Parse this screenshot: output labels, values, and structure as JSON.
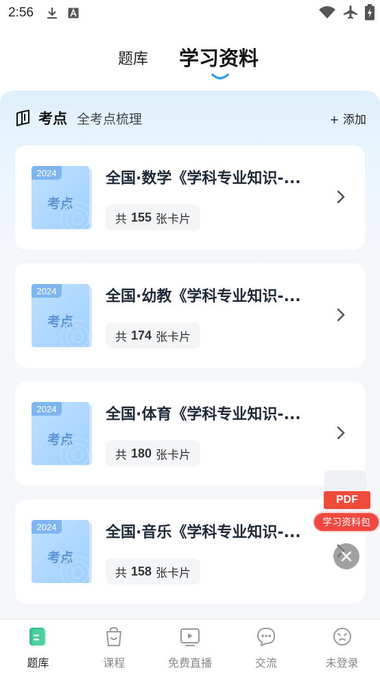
{
  "status_bar": {
    "time": "2:56"
  },
  "top_tabs": {
    "tab1": "题库",
    "tab2": "学习资料"
  },
  "section": {
    "title": "考点",
    "subtitle": "全考点梳理",
    "add_label": "+ 添加"
  },
  "cards": [
    {
      "year": "2024",
      "badge": "考点",
      "title": "全国·数学《学科专业知识-...",
      "count_prefix": "共",
      "count": "155",
      "count_suffix": "张卡片"
    },
    {
      "year": "2024",
      "badge": "考点",
      "title": "全国·幼教《学科专业知识-...",
      "count_prefix": "共",
      "count": "174",
      "count_suffix": "张卡片"
    },
    {
      "year": "2024",
      "badge": "考点",
      "title": "全国·体育《学科专业知识-...",
      "count_prefix": "共",
      "count": "180",
      "count_suffix": "张卡片"
    },
    {
      "year": "2024",
      "badge": "考点",
      "title": "全国·音乐《学科专业知识-...",
      "count_prefix": "共",
      "count": "158",
      "count_suffix": "张卡片"
    }
  ],
  "float_ad": {
    "pdf_label": "PDF",
    "pill_label": "学习资料包"
  },
  "bottom_nav": [
    {
      "label": "题库",
      "icon": "question-bank-icon",
      "active": true
    },
    {
      "label": "课程",
      "icon": "course-bag-icon",
      "active": false
    },
    {
      "label": "免费直播",
      "icon": "live-play-icon",
      "active": false
    },
    {
      "label": "交流",
      "icon": "chat-bubble-icon",
      "active": false
    },
    {
      "label": "未登录",
      "icon": "user-face-icon",
      "active": false
    }
  ],
  "colors": {
    "accent": "#2fc48d",
    "title": "#1e2a3a",
    "ad_red": "#f0473f",
    "tab_underline": "#3aa0f0"
  }
}
